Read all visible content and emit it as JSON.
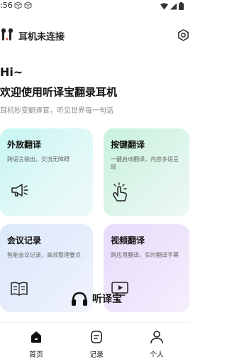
{
  "status_bar": {
    "time": ":56"
  },
  "topbar": {
    "title": "耳机未连接"
  },
  "greeting": "Hi~",
  "welcome": "欢迎使用听译宝翻录耳机",
  "subtitle": "耳机秒变翻译官，听见世界每一句话",
  "cards": {
    "speaker": {
      "title": "外放翻译",
      "desc": "跨语言输出，交流无障碍",
      "icon": "megaphone-icon"
    },
    "key": {
      "title": "按键翻译",
      "desc": "一键启动翻译，内容多语呈现",
      "icon": "tap-hand-icon"
    },
    "meeting": {
      "title": "会议记录",
      "desc": "智能会议记录，高效整理要点",
      "icon": "open-book-icon"
    },
    "video": {
      "title": "视频翻译",
      "desc": "跨应用翻译，实时翻译字幕",
      "icon": "video-play-icon"
    }
  },
  "brand": {
    "name": "听译宝"
  },
  "nav": {
    "home": "首页",
    "records": "记录",
    "profile": "个人"
  },
  "colors": {
    "speaker_card": "#c6f5f2",
    "key_card": "#c7f2dc",
    "meeting_card": "#dce8fb",
    "video_card": "#e8dcfb"
  }
}
